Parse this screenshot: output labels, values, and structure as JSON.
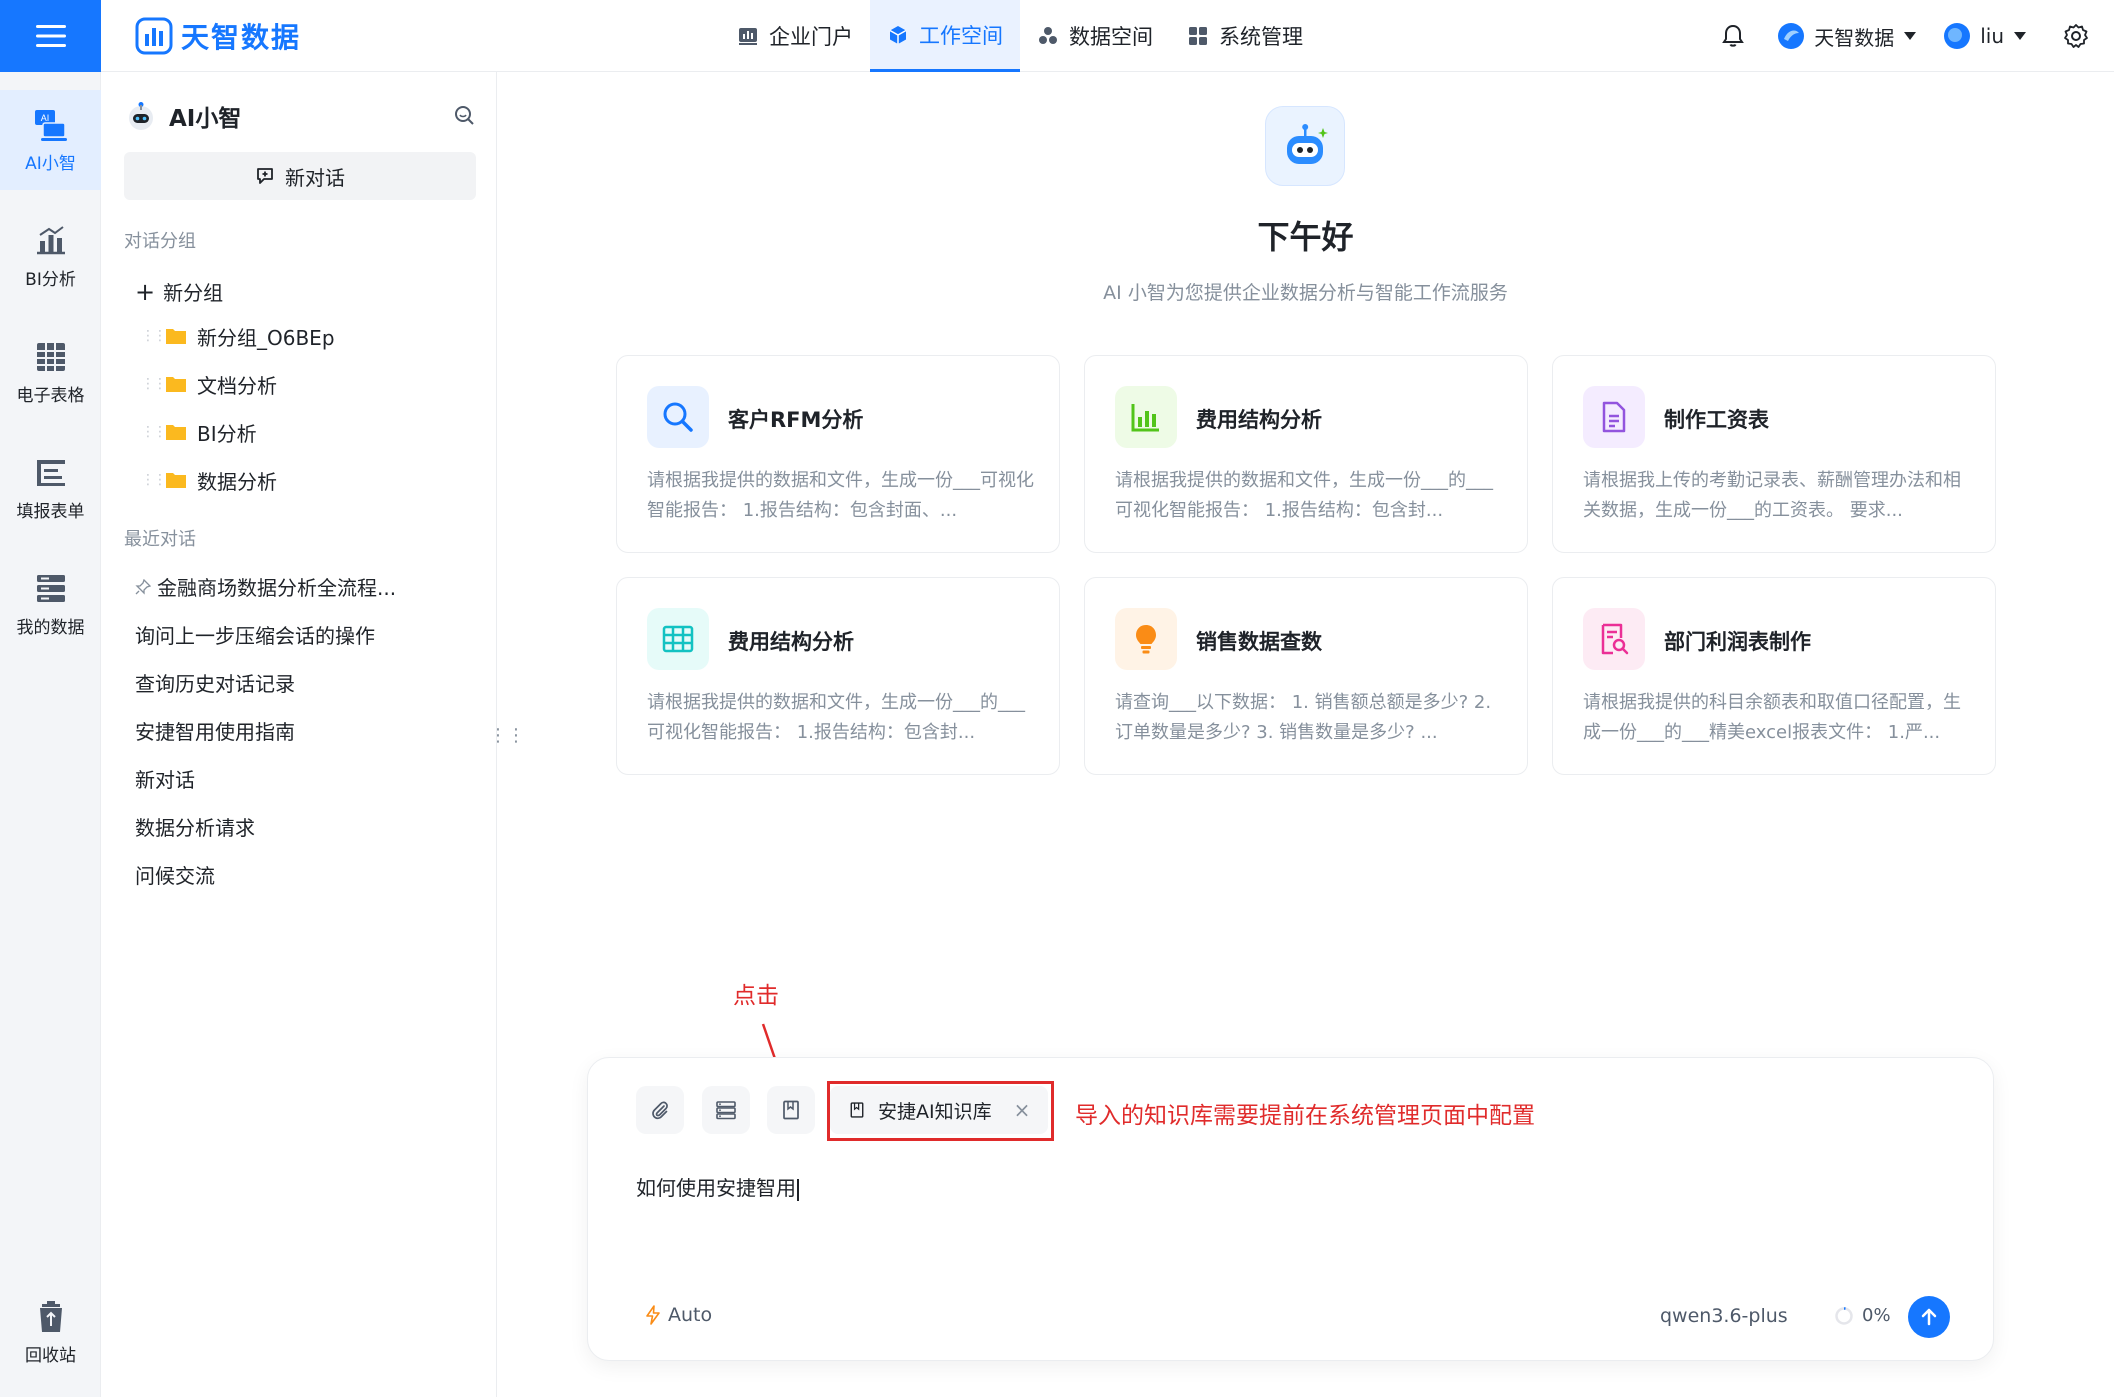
{
  "brand": {
    "name": "天智数据",
    "accent": "#1677ff"
  },
  "topnav": [
    {
      "label": "企业门户",
      "icon": "chart-board-icon"
    },
    {
      "label": "工作空间",
      "icon": "cube-icon",
      "active": true
    },
    {
      "label": "数据空间",
      "icon": "nodes-icon"
    },
    {
      "label": "系统管理",
      "icon": "grid-icon"
    }
  ],
  "header": {
    "org": "天智数据",
    "user": "liu"
  },
  "rail": [
    {
      "label": "AI小智",
      "icon": "ai-assistant-icon",
      "active": true
    },
    {
      "label": "BI分析",
      "icon": "bar-chart-icon"
    },
    {
      "label": "电子表格",
      "icon": "spreadsheet-icon"
    },
    {
      "label": "填报表单",
      "icon": "form-icon"
    },
    {
      "label": "我的数据",
      "icon": "database-icon"
    }
  ],
  "rail_bottom": {
    "label": "回收站",
    "icon": "recycle-bin-icon"
  },
  "sidebar": {
    "title": "AI小智",
    "new_chat": "新对话",
    "groups_label": "对话分组",
    "add_group": "新分组",
    "groups": [
      "新分组_O6BEp",
      "文档分析",
      "BI分析",
      "数据分析"
    ],
    "recent_label": "最近对话",
    "recent": [
      "金融商场数据分析全流程...",
      "询问上一步压缩会话的操作",
      "查询历史对话记录",
      "安捷智用使用指南",
      "新对话",
      "数据分析请求",
      "问候交流"
    ]
  },
  "main": {
    "greeting": "下午好",
    "subtitle": "AI 小智为您提供企业数据分析与智能工作流服务",
    "cards": [
      {
        "title": "客户RFM分析",
        "desc": "请根据我提供的数据和文件，生成一份___可视化智能报告： 1.报告结构：包含封面、...",
        "icon": "search-icon",
        "color": "#1677ff",
        "bg": "#e8f1ff"
      },
      {
        "title": "费用结构分析",
        "desc": "请根据我提供的数据和文件，生成一份___的___可视化智能报告： 1.报告结构：包含封...",
        "icon": "bar-chart-icon",
        "color": "#52c41a",
        "bg": "#eefbe6"
      },
      {
        "title": "制作工资表",
        "desc": "请根据我上传的考勤记录表、薪酬管理办法和相关数据，生成一份___的工资表。 要求...",
        "icon": "document-icon",
        "color": "#9254de",
        "bg": "#f4ecff"
      },
      {
        "title": "费用结构分析",
        "desc": "请根据我提供的数据和文件，生成一份___的___可视化智能报告： 1.报告结构：包含封...",
        "icon": "table-icon",
        "color": "#13c2c2",
        "bg": "#e6fbf9"
      },
      {
        "title": "销售数据查数",
        "desc": "请查询___以下数据： 1. 销售额总额是多少? 2. 订单数量是多少? 3. 销售数量是多少? ...",
        "icon": "lightbulb-icon",
        "color": "#fa8c16",
        "bg": "#fff3e6"
      },
      {
        "title": "部门利润表制作",
        "desc": "请根据我提供的科目余额表和取值口径配置，生成一份___的___精美excel报表文件： 1.严...",
        "icon": "report-search-icon",
        "color": "#eb2f96",
        "bg": "#fdebf4"
      }
    ]
  },
  "input": {
    "kb_chip": "安捷AI知识库",
    "text": "如何使用安捷智用",
    "mode": "Auto",
    "model": "qwen3.6-plus",
    "usage": "0%"
  },
  "annotations": {
    "click": "点击",
    "note": "导入的知识库需要提前在系统管理页面中配置",
    "color": "#e02b2b"
  }
}
